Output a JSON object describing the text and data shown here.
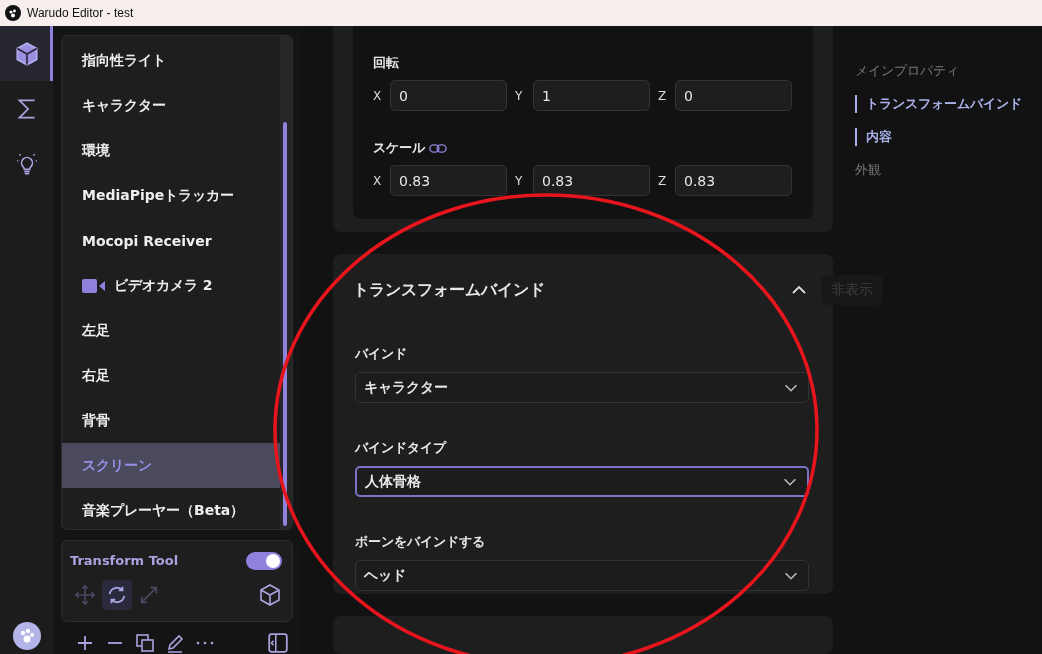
{
  "window": {
    "title": "Warudo Editor - test"
  },
  "rail": [
    {
      "kind": "cube",
      "selected": true
    },
    {
      "kind": "sigma",
      "selected": false
    },
    {
      "kind": "bulb",
      "selected": false
    }
  ],
  "asset_list": [
    {
      "label": "指向性ライト",
      "selected": false
    },
    {
      "label": "キャラクター",
      "selected": false
    },
    {
      "label": "環境",
      "selected": false
    },
    {
      "label": "MediaPipeトラッカー",
      "selected": false
    },
    {
      "label": "Mocopi Receiver",
      "selected": false
    },
    {
      "label": "ビデオカメラ 2",
      "selected": false,
      "kind": "camera"
    },
    {
      "label": "左足",
      "selected": false
    },
    {
      "label": "右足",
      "selected": false
    },
    {
      "label": "背骨",
      "selected": false
    },
    {
      "label": "スクリーン",
      "selected": true
    },
    {
      "label": "音楽プレーヤー（Beta）",
      "selected": false
    }
  ],
  "transform_tool": {
    "label": "Transform Tool",
    "on": true,
    "tools": [
      {
        "kind": "move",
        "selected": false
      },
      {
        "kind": "rotate",
        "selected": true
      },
      {
        "kind": "scale",
        "selected": false
      }
    ]
  },
  "rotation": {
    "label": "回転",
    "fields": [
      {
        "axis": "X",
        "value": "0"
      },
      {
        "axis": "Y",
        "value": "1"
      },
      {
        "axis": "Z",
        "value": "0"
      }
    ]
  },
  "scale": {
    "label": "スケール",
    "fields": [
      {
        "axis": "X",
        "value": "0.83"
      },
      {
        "axis": "Y",
        "value": "0.83"
      },
      {
        "axis": "Z",
        "value": "0.83"
      }
    ]
  },
  "transform_bind": {
    "title": "トランスフォームバインド",
    "expanded": true,
    "tooltip": "非表示",
    "fields": [
      {
        "label": "バインド",
        "value": "キャラクター",
        "focused": false
      },
      {
        "label": "バインドタイプ",
        "value": "人体骨格",
        "focused": true
      },
      {
        "label": "ボーンをバインドする",
        "value": "ヘッド",
        "focused": false
      }
    ]
  },
  "outline": [
    {
      "label": "メインプロパティ",
      "active": false
    },
    {
      "label": "トランスフォームバインド",
      "active": true
    },
    {
      "label": "内容",
      "active": true
    },
    {
      "label": "外観",
      "active": false
    }
  ]
}
